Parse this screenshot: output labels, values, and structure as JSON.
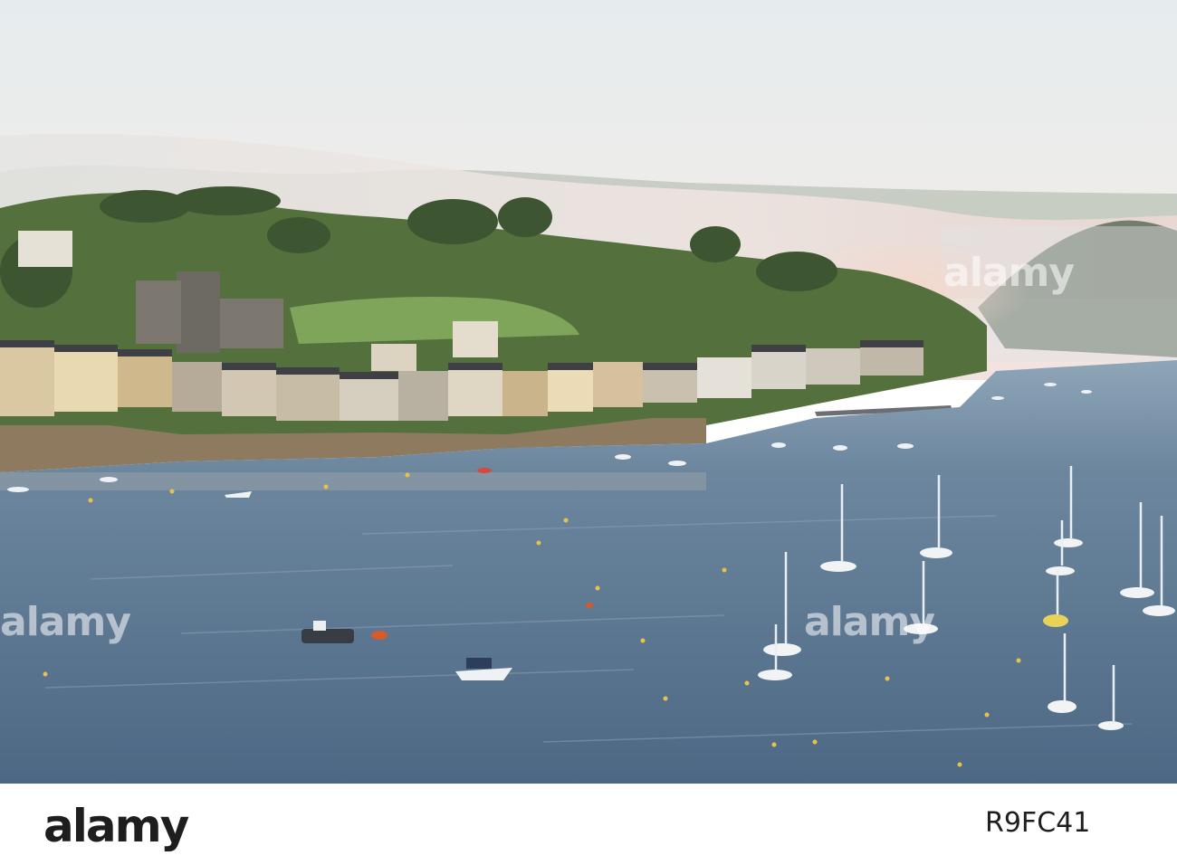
{
  "watermark": {
    "text": "alamy",
    "color": "#ffffff"
  },
  "footer": {
    "brand": "alamy",
    "image_code": "R9FC41"
  },
  "colors": {
    "sky": "#eaeef0",
    "fog": "#e9e3e4",
    "water": "#5f7a95",
    "foliage": "#4e6a3a",
    "stone": "#9c8566"
  }
}
